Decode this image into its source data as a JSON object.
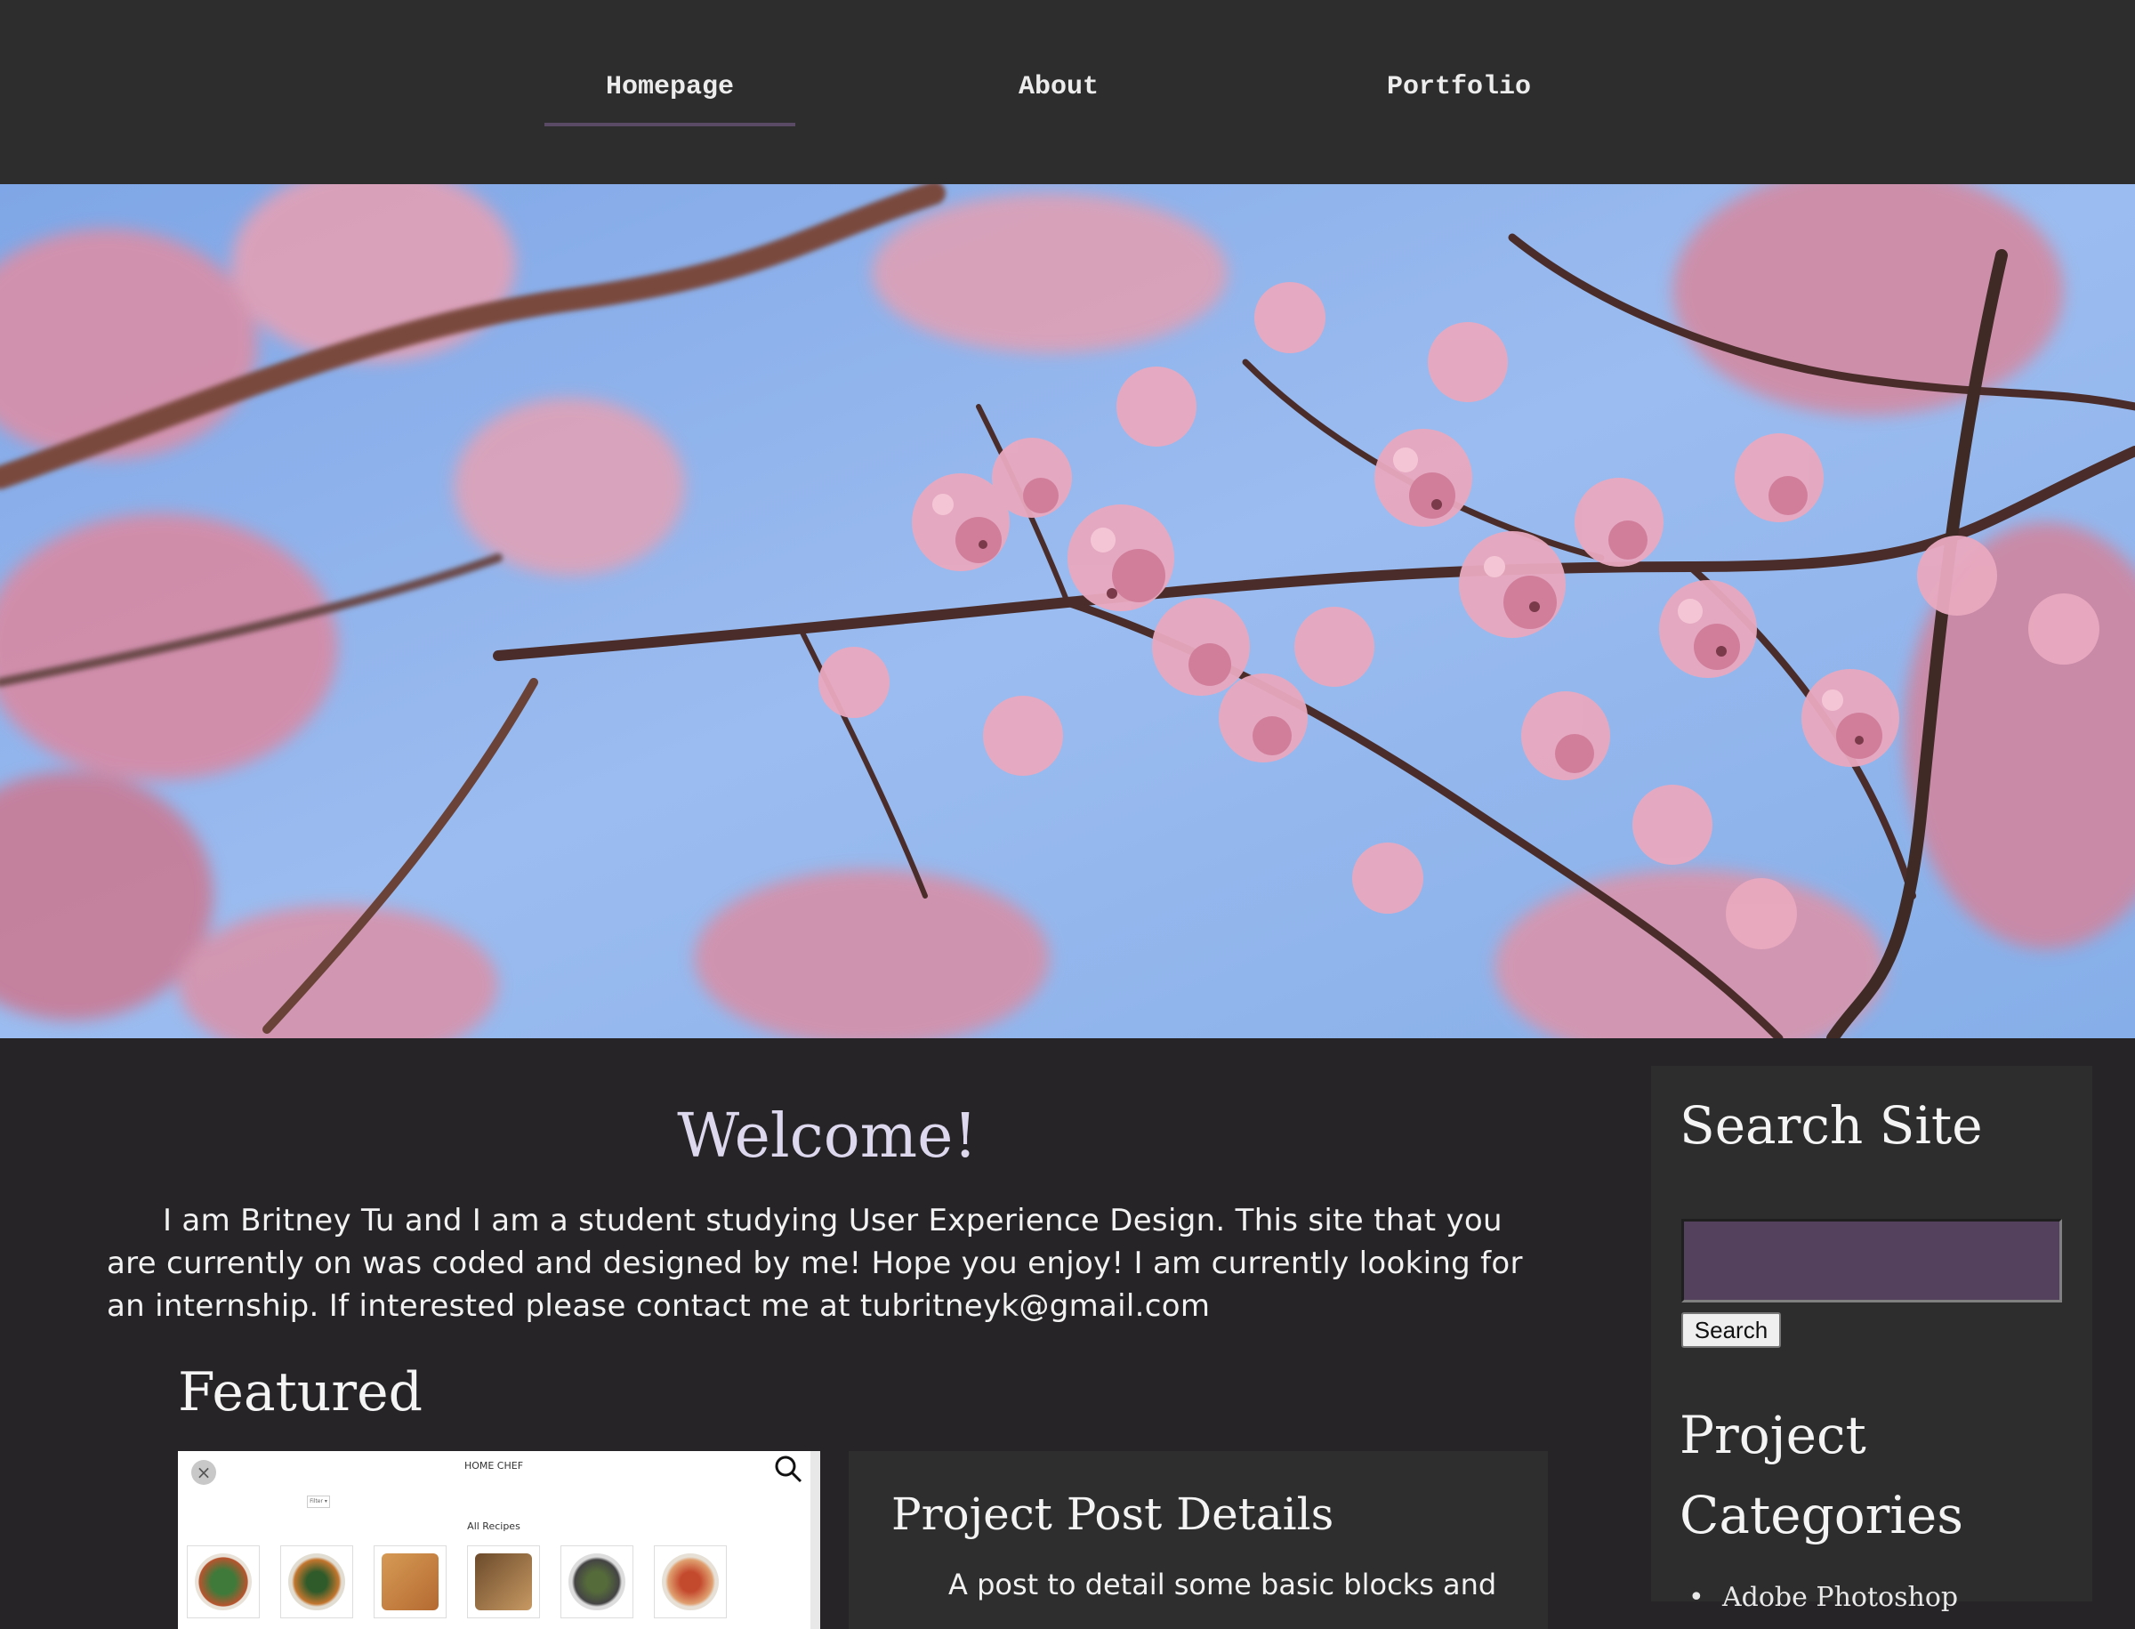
{
  "nav": {
    "items": [
      {
        "label": "Homepage",
        "active": true
      },
      {
        "label": "About",
        "active": false
      },
      {
        "label": "Portfolio",
        "active": false
      }
    ]
  },
  "colors": {
    "page_bg": "#272427",
    "header_bg": "#2d2d2d",
    "accent": "#5b4a66",
    "title_lavender": "#ded8ee",
    "search_input_bg": "#54415e"
  },
  "main": {
    "welcome_title": "Welcome!",
    "intro": "I am Britney Tu and I am a student studying User Experience Design. This site that you are currently on was coded and designed by me! Hope you enjoy! I am currently looking for an internship. If interested please contact me at tubritneyk@gmail.com",
    "featured_title": "Featured",
    "featured_thumbnail": {
      "brand": "HOME CHEF",
      "filter": "Filter ▾",
      "section": "All Recipes"
    },
    "post_card": {
      "title": "Project Post Details",
      "excerpt": "A post to detail some basic blocks and"
    }
  },
  "sidebar": {
    "search_heading": "Search Site",
    "search_value": "",
    "search_button": "Search",
    "categories_heading": "Project Categories",
    "categories": [
      "Adobe Photoshop"
    ]
  },
  "icons": {
    "close": "close-icon",
    "search": "search-icon"
  }
}
